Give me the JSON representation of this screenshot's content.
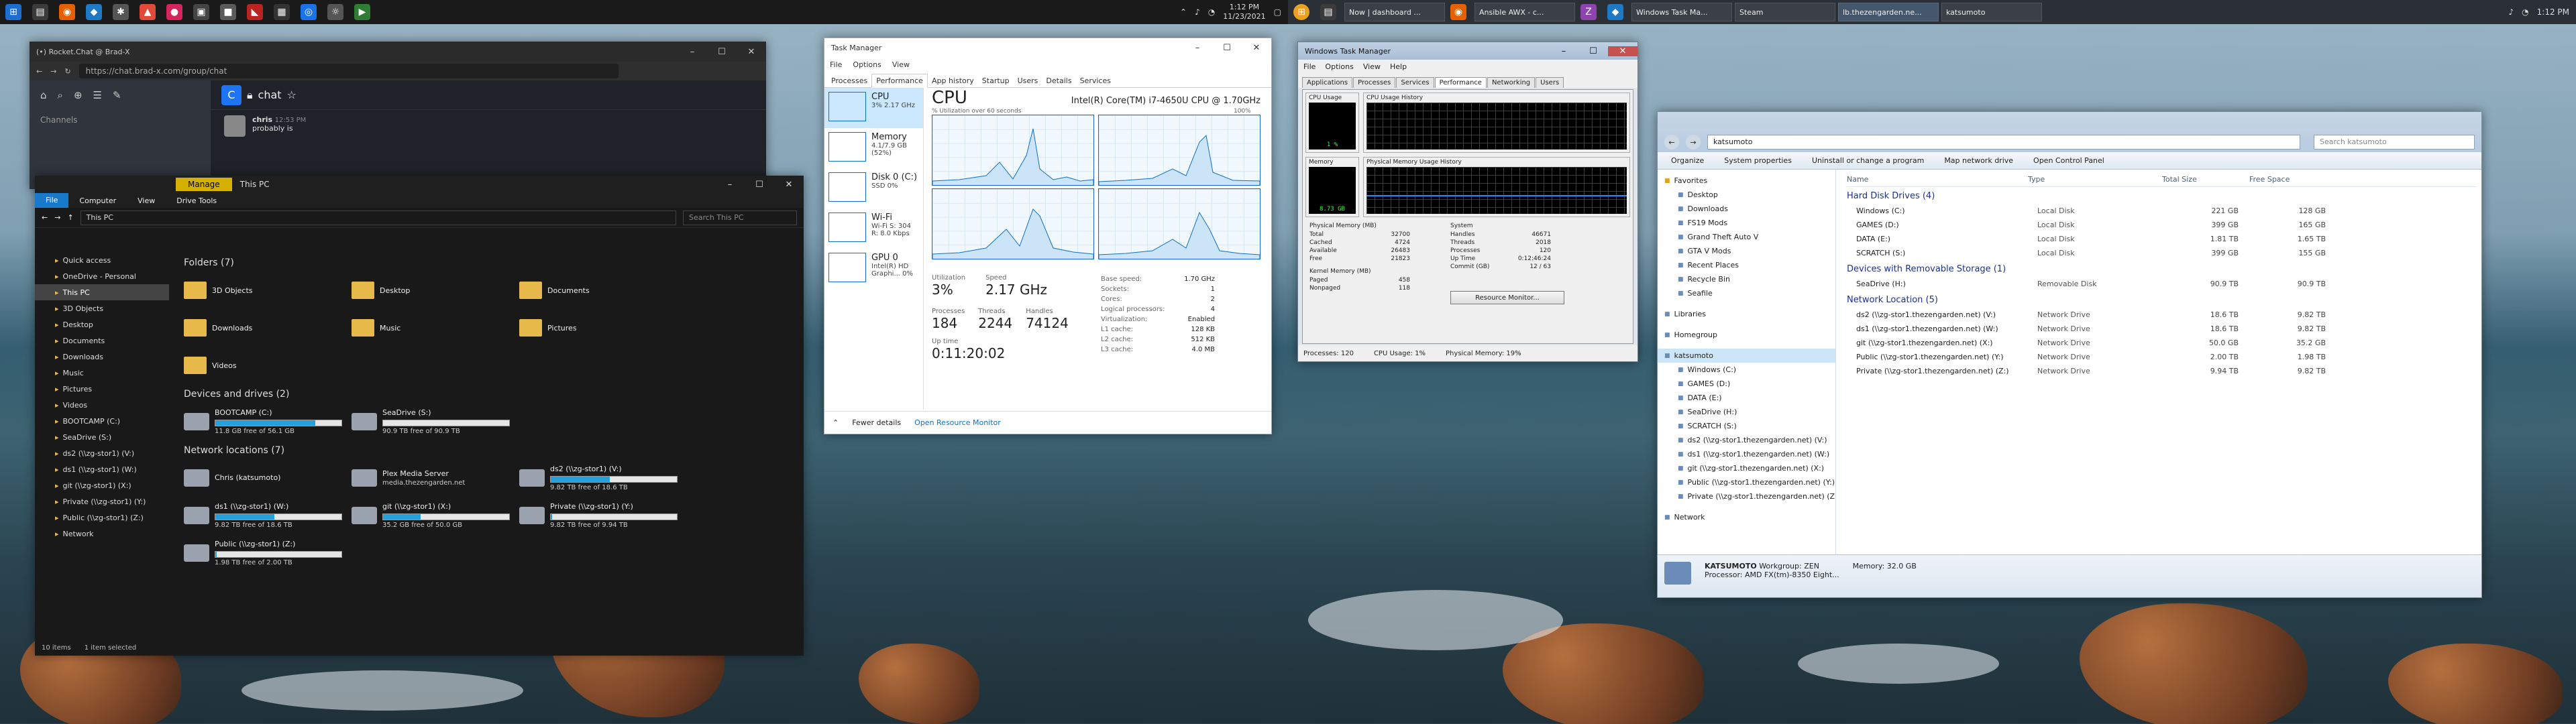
{
  "left_taskbar": {
    "clock_time": "1:12 PM",
    "clock_date": "11/23/2021"
  },
  "right_taskbar": {
    "tasks": [
      {
        "label": "Now | dashboard ..."
      },
      {
        "label": "Ansible AWX - c..."
      },
      {
        "label": "Windows Task Ma..."
      },
      {
        "label": "Steam"
      },
      {
        "label": "lb.thezengarden.ne..."
      },
      {
        "label": "katsumoto"
      }
    ],
    "clock_time": "1:12 PM"
  },
  "rocketchat": {
    "tab_title": "(•) Rocket.Chat @ Brad-X",
    "url": "https://chat.brad-x.com/group/chat",
    "channels_label": "Channels",
    "channel": "chat",
    "message_user": "chris",
    "message_time": "12:53 PM",
    "message_text": "probably is"
  },
  "explorer10": {
    "ribbon_manage": "Manage",
    "ribbon_title": "This PC",
    "tabs": [
      "File",
      "Computer",
      "View",
      "Drive Tools"
    ],
    "address": "This PC",
    "search_placeholder": "Search This PC",
    "nav": [
      "Quick access",
      "OneDrive - Personal",
      "This PC",
      "3D Objects",
      "Desktop",
      "Documents",
      "Downloads",
      "Music",
      "Pictures",
      "Videos",
      "BOOTCAMP (C:)",
      "SeaDrive (S:)",
      "ds2 (\\\\zg-stor1) (V:)",
      "ds1 (\\\\zg-stor1) (W:)",
      "git (\\\\zg-stor1) (X:)",
      "Private (\\\\zg-stor1) (Y:)",
      "Public (\\\\zg-stor1) (Z:)",
      "Network"
    ],
    "folders_header": "Folders (7)",
    "folders": [
      "3D Objects",
      "Desktop",
      "Documents",
      "Downloads",
      "Music",
      "Pictures",
      "Videos"
    ],
    "devices_header": "Devices and drives (2)",
    "devices": [
      {
        "name": "BOOTCAMP (C:)",
        "free": "11.8 GB free of 56.1 GB",
        "used_fraction": 0.79
      },
      {
        "name": "SeaDrive (S:)",
        "free": "90.9 TB free of 90.9 TB",
        "used_fraction": 0.0
      }
    ],
    "network_header": "Network locations (7)",
    "network": [
      {
        "name": "Chris (katsumoto)",
        "free": ""
      },
      {
        "name": "Plex Media Server",
        "free": "media.thezengarden.net"
      },
      {
        "name": "ds2 (\\\\zg-stor1) (V:)",
        "free": "9.82 TB free of 18.6 TB",
        "used_fraction": 0.47
      },
      {
        "name": "ds1 (\\\\zg-stor1) (W:)",
        "free": "9.82 TB free of 18.6 TB",
        "used_fraction": 0.47
      },
      {
        "name": "git (\\\\zg-stor1) (X:)",
        "free": "35.2 GB free of 50.0 GB",
        "used_fraction": 0.3
      },
      {
        "name": "Private (\\\\zg-stor1) (Y:)",
        "free": "9.82 TB free of 9.94 TB",
        "used_fraction": 0.01
      },
      {
        "name": "Public (\\\\zg-stor1) (Z:)",
        "free": "1.98 TB free of 2.00 TB",
        "used_fraction": 0.01
      }
    ],
    "status_items": "10 items",
    "status_selected": "1 item selected"
  },
  "taskmgr10": {
    "title": "Task Manager",
    "menu": [
      "File",
      "Options",
      "View"
    ],
    "tabs": [
      "Processes",
      "Performance",
      "App history",
      "Startup",
      "Users",
      "Details",
      "Services"
    ],
    "resources": [
      {
        "name": "CPU",
        "value": "3% 2.17 GHz"
      },
      {
        "name": "Memory",
        "value": "4.1/7.9 GB (52%)"
      },
      {
        "name": "Disk 0 (C:)",
        "value": "SSD 0%"
      },
      {
        "name": "Wi-Fi",
        "value": "Wi-Fi S: 304 R: 8.0 Kbps"
      },
      {
        "name": "GPU 0",
        "value": "Intel(R) HD Graphi... 0%"
      }
    ],
    "heading": "CPU",
    "cpu_name": "Intel(R) Core(TM) i7-4650U CPU @ 1.70GHz",
    "graph_caption": "% Utilization over 60 seconds",
    "graph_max": "100%",
    "utilization_label": "Utilization",
    "utilization": "3%",
    "speed_label": "Speed",
    "speed": "2.17 GHz",
    "processes_label": "Processes",
    "processes": "184",
    "threads_label": "Threads",
    "threads": "2244",
    "handles_label": "Handles",
    "handles": "74124",
    "uptime_label": "Up time",
    "uptime": "0:11:20:02",
    "specs": [
      {
        "k": "Base speed:",
        "v": "1.70 GHz"
      },
      {
        "k": "Sockets:",
        "v": "1"
      },
      {
        "k": "Cores:",
        "v": "2"
      },
      {
        "k": "Logical processors:",
        "v": "4"
      },
      {
        "k": "Virtualization:",
        "v": "Enabled"
      },
      {
        "k": "L1 cache:",
        "v": "128 KB"
      },
      {
        "k": "L2 cache:",
        "v": "512 KB"
      },
      {
        "k": "L3 cache:",
        "v": "4.0 MB"
      }
    ],
    "fewer_details": "Fewer details",
    "open_resmon": "Open Resource Monitor"
  },
  "taskmgr7": {
    "title": "Windows Task Manager",
    "menu": [
      "File",
      "Options",
      "View",
      "Help"
    ],
    "tabs": [
      "Applications",
      "Processes",
      "Services",
      "Performance",
      "Networking",
      "Users"
    ],
    "cpu_usage_label": "CPU Usage",
    "cpu_usage": "1 %",
    "cpu_history_label": "CPU Usage History",
    "memory_label": "Memory",
    "memory": "8.73 GB",
    "mem_history_label": "Physical Memory Usage History",
    "phys_mem_header": "Physical Memory (MB)",
    "phys_mem": [
      {
        "k": "Total",
        "v": "32700"
      },
      {
        "k": "Cached",
        "v": "4724"
      },
      {
        "k": "Available",
        "v": "26483"
      },
      {
        "k": "Free",
        "v": "21823"
      }
    ],
    "system_header": "System",
    "system": [
      {
        "k": "Handles",
        "v": "46671"
      },
      {
        "k": "Threads",
        "v": "2018"
      },
      {
        "k": "Processes",
        "v": "120"
      },
      {
        "k": "Up Time",
        "v": "0:12:46:24"
      },
      {
        "k": "Commit (GB)",
        "v": "12 / 63"
      }
    ],
    "kernel_header": "Kernel Memory (MB)",
    "kernel": [
      {
        "k": "Paged",
        "v": "458"
      },
      {
        "k": "Nonpaged",
        "v": "118"
      }
    ],
    "resmon_button": "Resource Monitor...",
    "status_processes": "Processes: 120",
    "status_cpu": "CPU Usage: 1%",
    "status_mem": "Physical Memory: 19%"
  },
  "explorer7": {
    "breadcrumb": "katsumoto",
    "search_placeholder": "Search katsumoto",
    "commands": [
      "Organize",
      "System properties",
      "Uninstall or change a program",
      "Map network drive",
      "Open Control Panel"
    ],
    "favorites": [
      "Favorites",
      "Desktop",
      "Downloads",
      "FS19 Mods",
      "Grand Theft Auto V",
      "GTA V Mods",
      "Recent Places",
      "Recycle Bin",
      "Seafile"
    ],
    "libraries": "Libraries",
    "homegroup": "Homegroup",
    "computer": [
      "katsumoto",
      "Windows (C:)",
      "GAMES (D:)",
      "DATA (E:)",
      "SeaDrive (H:)",
      "SCRATCH (S:)",
      "ds2 (\\\\zg-stor1.thezengarden.net) (V:)",
      "ds1 (\\\\zg-stor1.thezengarden.net) (W:)",
      "git (\\\\zg-stor1.thezengarden.net) (X:)",
      "Public (\\\\zg-stor1.thezengarden.net) (Y:)",
      "Private (\\\\zg-stor1.thezengarden.net) (Z:)"
    ],
    "network": "Network",
    "columns": [
      "Name",
      "Type",
      "Total Size",
      "Free Space"
    ],
    "hdd_header": "Hard Disk Drives (4)",
    "hdd": [
      {
        "name": "Windows (C:)",
        "type": "Local Disk",
        "total": "221 GB",
        "free": "128 GB"
      },
      {
        "name": "GAMES (D:)",
        "type": "Local Disk",
        "total": "399 GB",
        "free": "165 GB"
      },
      {
        "name": "DATA (E:)",
        "type": "Local Disk",
        "total": "1.81 TB",
        "free": "1.65 TB"
      },
      {
        "name": "SCRATCH (S:)",
        "type": "Local Disk",
        "total": "399 GB",
        "free": "155 GB"
      }
    ],
    "removable_header": "Devices with Removable Storage (1)",
    "removable": [
      {
        "name": "SeaDrive (H:)",
        "type": "Removable Disk",
        "total": "90.9 TB",
        "free": "90.9 TB"
      }
    ],
    "net_header": "Network Location (5)",
    "net": [
      {
        "name": "ds2 (\\\\zg-stor1.thezengarden.net) (V:)",
        "type": "Network Drive",
        "total": "18.6 TB",
        "free": "9.82 TB"
      },
      {
        "name": "ds1 (\\\\zg-stor1.thezengarden.net) (W:)",
        "type": "Network Drive",
        "total": "18.6 TB",
        "free": "9.82 TB"
      },
      {
        "name": "git (\\\\zg-stor1.thezengarden.net) (X:)",
        "type": "Network Drive",
        "total": "50.0 GB",
        "free": "35.2 GB"
      },
      {
        "name": "Public (\\\\zg-stor1.thezengarden.net) (Y:)",
        "type": "Network Drive",
        "total": "2.00 TB",
        "free": "1.98 TB"
      },
      {
        "name": "Private (\\\\zg-stor1.thezengarden.net) (Z:)",
        "type": "Network Drive",
        "total": "9.94 TB",
        "free": "9.82 TB"
      }
    ],
    "details_name": "KATSUMOTO",
    "details_workgroup": "Workgroup: ZEN",
    "details_memory": "Memory: 32.0 GB",
    "details_processor": "Processor: AMD FX(tm)-8350 Eight..."
  }
}
